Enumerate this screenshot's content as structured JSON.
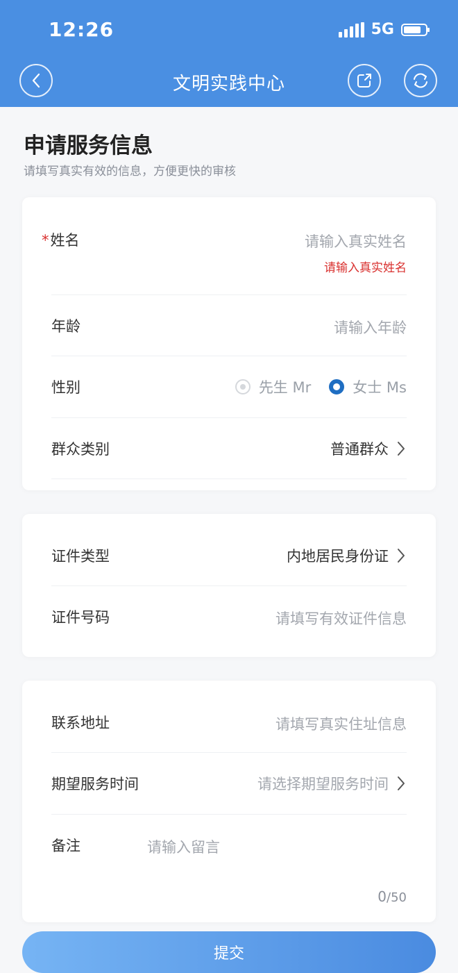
{
  "status_bar": {
    "time": "12:26",
    "network": "5G",
    "battery_level": 0.7
  },
  "nav": {
    "title": "文明实践中心"
  },
  "page": {
    "title": "申请服务信息",
    "subtitle": "请填写真实有效的信息，方便更快的审核"
  },
  "colors": {
    "brand": "#4a8fe2",
    "error": "#d9312f",
    "radio_selected": "#1f6ec2"
  },
  "form": {
    "name": {
      "required_mark": "*",
      "label": "姓名",
      "placeholder": "请输入真实姓名",
      "error": "请输入真实姓名"
    },
    "age": {
      "label": "年龄",
      "placeholder": "请输入年龄"
    },
    "gender": {
      "label": "性别",
      "options": [
        "先生 Mr",
        "女士 Ms"
      ],
      "selected": "女士 Ms"
    },
    "group": {
      "label": "群众类别",
      "value": "普通群众"
    },
    "id_type": {
      "label": "证件类型",
      "value": "内地居民身份证"
    },
    "id_number": {
      "label": "证件号码",
      "placeholder": "请填写有效证件信息"
    },
    "address": {
      "label": "联系地址",
      "placeholder": "请填写真实住址信息"
    },
    "service_time": {
      "label": "期望服务时间",
      "placeholder": "请选择期望服务时间"
    },
    "remark": {
      "label": "备注",
      "placeholder": "请输入留言",
      "count": "0",
      "max": "/50"
    }
  },
  "submit_label": "提交",
  "icons": {
    "back": "chevron-left-icon",
    "share": "share-icon",
    "refresh": "refresh-icon",
    "chevron": "chevron-right-icon"
  }
}
